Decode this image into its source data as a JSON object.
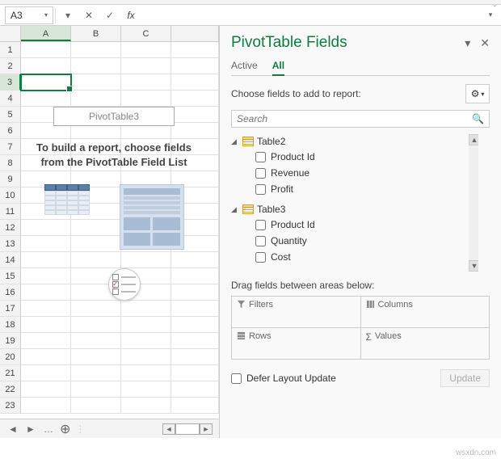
{
  "formula_bar": {
    "name_box": "A3",
    "fx_label": "fx"
  },
  "grid": {
    "columns": [
      "A",
      "B",
      "C"
    ],
    "rows": [
      "1",
      "2",
      "3",
      "4",
      "5",
      "6",
      "7",
      "8",
      "9",
      "10",
      "11",
      "12",
      "13",
      "14",
      "15",
      "16",
      "17",
      "18",
      "19",
      "20",
      "21",
      "22",
      "23"
    ],
    "selected_cell": "A3"
  },
  "pivot_placeholder": {
    "name": "PivotTable3",
    "message": "To build a report, choose fields from the PivotTable Field List"
  },
  "pane": {
    "title": "PivotTable Fields",
    "tabs": {
      "active": "Active",
      "all": "All",
      "selected": "All"
    },
    "choose_label": "Choose fields to add to report:",
    "search_placeholder": "Search",
    "tables": [
      {
        "name": "Table2",
        "fields": [
          "Product Id",
          "Revenue",
          "Profit"
        ]
      },
      {
        "name": "Table3",
        "fields": [
          "Product Id",
          "Quantity",
          "Cost"
        ]
      }
    ],
    "drag_label": "Drag fields between areas below:",
    "areas": {
      "filters": "Filters",
      "columns": "Columns",
      "rows": "Rows",
      "values": "Values"
    },
    "defer_label": "Defer Layout Update",
    "update_label": "Update"
  },
  "watermark": "wsxdn.com"
}
